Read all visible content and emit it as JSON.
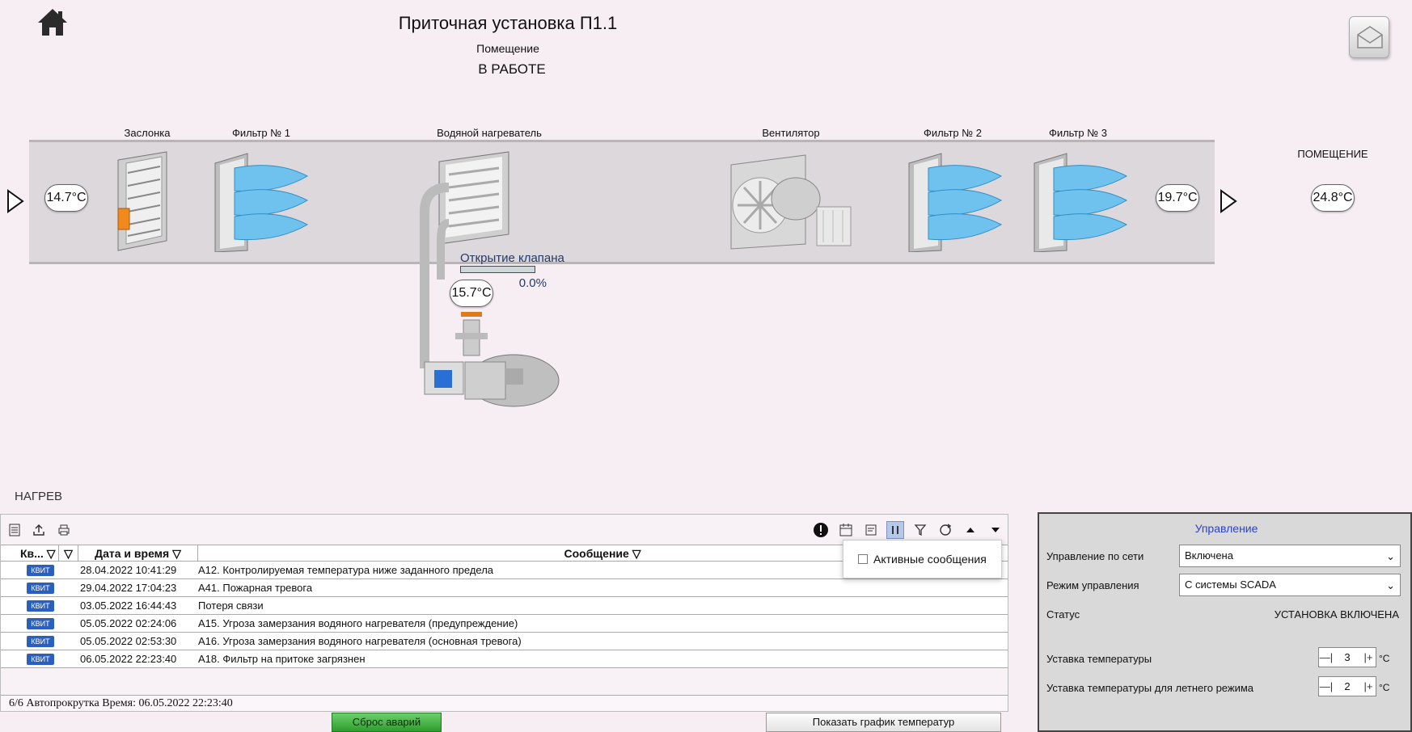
{
  "header": {
    "title": "Приточная установка П1.1",
    "subtitle": "Помещение",
    "status": "В РАБОТЕ"
  },
  "components": {
    "damper": "Заслонка",
    "filter1": "Фильтр № 1",
    "heater": "Водяной нагреватель",
    "fan": "Вентилятор",
    "filter2": "Фильтр № 2",
    "filter3": "Фильтр № 3",
    "room": "ПОМЕЩЕНИЕ"
  },
  "temperatures": {
    "inlet": "14.7°C",
    "outlet": "19.7°C",
    "room": "24.8°C",
    "water": "15.7°C"
  },
  "valve": {
    "label": "Открытие клапана",
    "value_text": "0.0%",
    "value": 0.0
  },
  "section_label": "НАГРЕВ",
  "alarms": {
    "columns": {
      "ack": "Кв...",
      "datetime": "Дата и время",
      "message": "Сообщение"
    },
    "ack_label": "КВИТ",
    "rows": [
      {
        "datetime": "28.04.2022 10:41:29",
        "message": "A12. Контролируемая температура ниже заданного предела"
      },
      {
        "datetime": "29.04.2022 17:04:23",
        "message": "A41. Пожарная тревога"
      },
      {
        "datetime": "03.05.2022 16:44:43",
        "message": "Потеря связи"
      },
      {
        "datetime": "05.05.2022 02:24:06",
        "message": "A15. Угроза замерзания водяного нагревателя (предупреждение)"
      },
      {
        "datetime": "05.05.2022 02:53:30",
        "message": "A16. Угроза замерзания водяного нагревателя (основная тревога)"
      },
      {
        "datetime": "06.05.2022 22:23:40",
        "message": "A18. Фильтр на притоке загрязнен"
      }
    ],
    "footer": "6/6 Автопрокрутка Время: 06.05.2022 22:23:40",
    "popup_option": "Активные сообщения"
  },
  "buttons": {
    "reset": "Сброс аварий",
    "chart": "Показать график температур"
  },
  "control": {
    "title": "Управление",
    "network_label": "Управление по сети",
    "network_value": "Включена",
    "mode_label": "Режим управления",
    "mode_value": "С системы SCADA",
    "status_label": "Статус",
    "status_value": "УСТАНОВКА ВКЛЮЧЕНА",
    "setpoint_label": "Уставка температуры",
    "setpoint_value": "3",
    "summer_label": "Уставка температуры для летнего режима",
    "summer_value": "2",
    "unit": "°C"
  },
  "colors": {
    "background": "#f6eef3",
    "accent_blue": "#2a43cc",
    "ack_blue": "#2a5fbf",
    "reset_green": "#2e9c2e"
  }
}
